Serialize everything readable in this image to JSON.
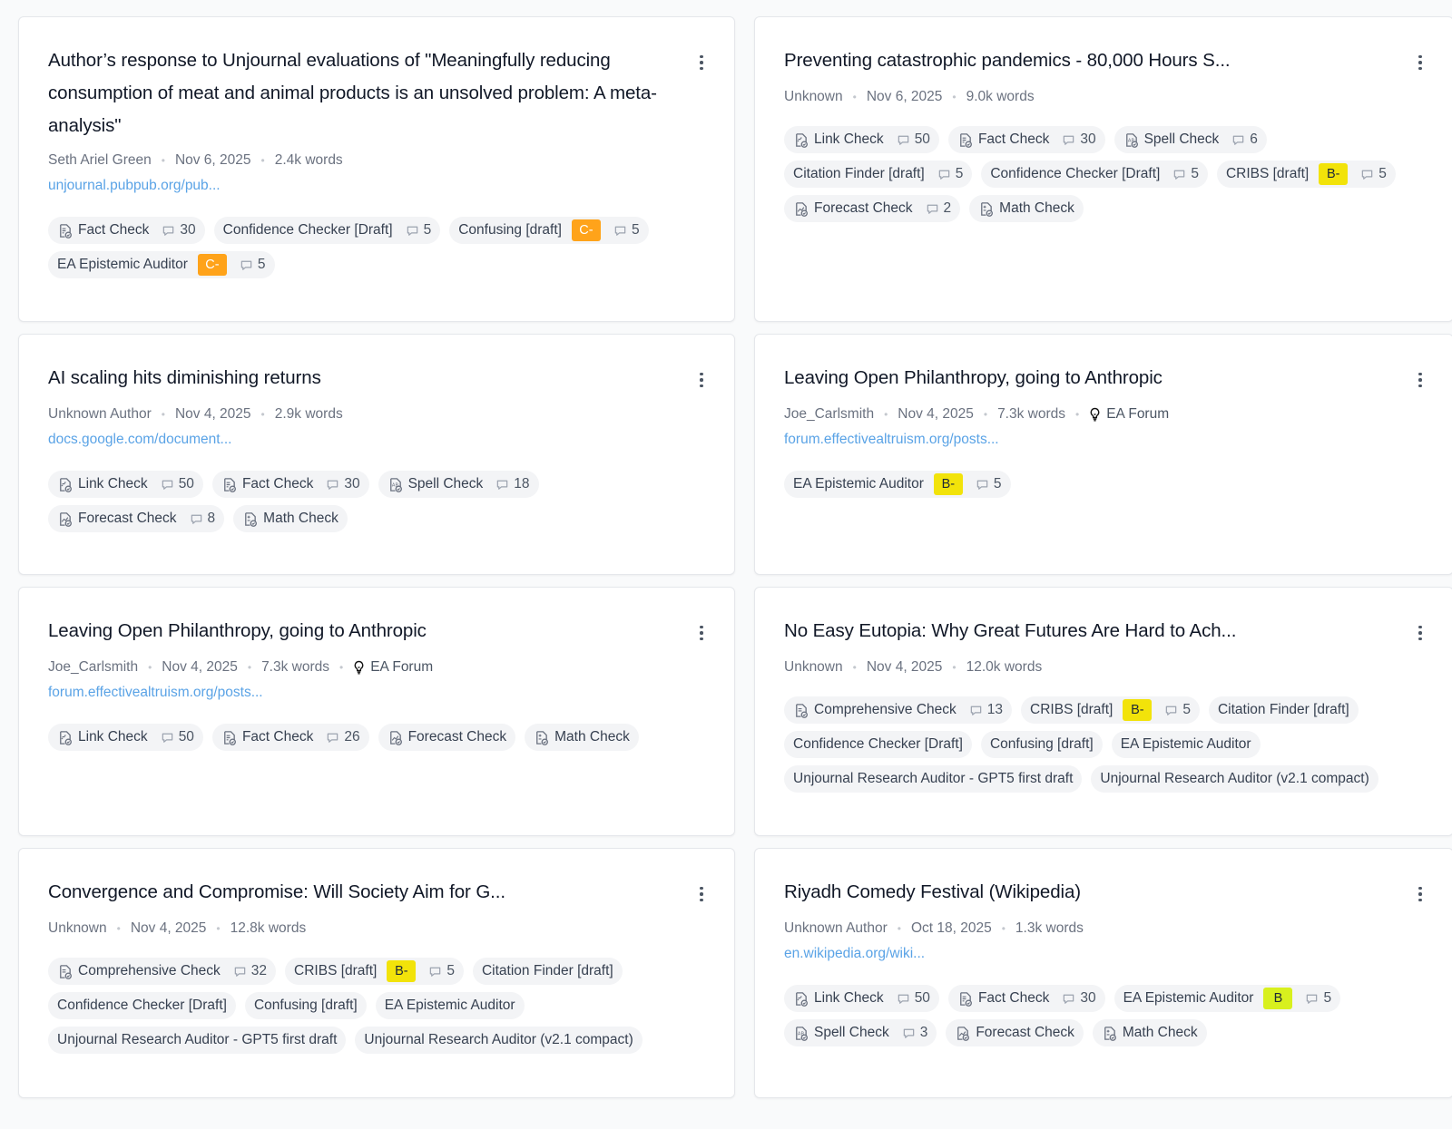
{
  "cards": [
    {
      "title": "Author’s response to Unjournal evaluations of \"Meaningfully reducing consumption of meat and animal products is an unsolved problem: A meta-analysis\"",
      "author": "Seth Ariel Green",
      "date": "Nov 6, 2025",
      "words": "2.4k words",
      "platform": "",
      "link": "unjournal.pubpub.org/pub...",
      "tags": [
        {
          "label": "Fact Check",
          "icon": "fact-check-icon",
          "comments": "30",
          "grade": ""
        },
        {
          "label": "Confidence Checker [Draft]",
          "icon": "",
          "comments": "5",
          "grade": ""
        },
        {
          "label": "Confusing [draft]",
          "icon": "",
          "comments": "5",
          "grade": "C-"
        },
        {
          "label": "EA Epistemic Auditor",
          "icon": "",
          "comments": "5",
          "grade": "C-"
        }
      ]
    },
    {
      "title": "Preventing catastrophic pandemics - 80,000 Hours S...",
      "author": "Unknown",
      "date": "Nov 6, 2025",
      "words": "9.0k words",
      "platform": "",
      "link": "",
      "tags": [
        {
          "label": "Link Check",
          "icon": "link-check-icon",
          "comments": "50",
          "grade": ""
        },
        {
          "label": "Fact Check",
          "icon": "fact-check-icon",
          "comments": "30",
          "grade": ""
        },
        {
          "label": "Spell Check",
          "icon": "spell-check-icon",
          "comments": "6",
          "grade": ""
        },
        {
          "label": "Citation Finder [draft]",
          "icon": "",
          "comments": "5",
          "grade": ""
        },
        {
          "label": "Confidence Checker [Draft]",
          "icon": "",
          "comments": "5",
          "grade": ""
        },
        {
          "label": "CRIBS [draft]",
          "icon": "",
          "comments": "5",
          "grade": "B-"
        },
        {
          "label": "Forecast Check",
          "icon": "forecast-check-icon",
          "comments": "2",
          "grade": ""
        },
        {
          "label": "Math Check",
          "icon": "math-check-icon",
          "comments": "",
          "grade": ""
        }
      ]
    },
    {
      "title": "AI scaling hits diminishing returns",
      "author": "Unknown Author",
      "date": "Nov 4, 2025",
      "words": "2.9k words",
      "platform": "",
      "link": "docs.google.com/document...",
      "tags": [
        {
          "label": "Link Check",
          "icon": "link-check-icon",
          "comments": "50",
          "grade": ""
        },
        {
          "label": "Fact Check",
          "icon": "fact-check-icon",
          "comments": "30",
          "grade": ""
        },
        {
          "label": "Spell Check",
          "icon": "spell-check-icon",
          "comments": "18",
          "grade": ""
        },
        {
          "label": "Forecast Check",
          "icon": "forecast-check-icon",
          "comments": "8",
          "grade": ""
        },
        {
          "label": "Math Check",
          "icon": "math-check-icon",
          "comments": "",
          "grade": ""
        }
      ]
    },
    {
      "title": "Leaving Open Philanthropy, going to Anthropic",
      "author": "Joe_Carlsmith",
      "date": "Nov 4, 2025",
      "words": "7.3k words",
      "platform": "EA Forum",
      "link": "forum.effectivealtruism.org/posts...",
      "tags": [
        {
          "label": "EA Epistemic Auditor",
          "icon": "",
          "comments": "5",
          "grade": "B-"
        }
      ]
    },
    {
      "title": "Leaving Open Philanthropy, going to Anthropic",
      "author": "Joe_Carlsmith",
      "date": "Nov 4, 2025",
      "words": "7.3k words",
      "platform": "EA Forum",
      "link": "forum.effectivealtruism.org/posts...",
      "tags": [
        {
          "label": "Link Check",
          "icon": "link-check-icon",
          "comments": "50",
          "grade": ""
        },
        {
          "label": "Fact Check",
          "icon": "fact-check-icon",
          "comments": "26",
          "grade": ""
        },
        {
          "label": "Forecast Check",
          "icon": "forecast-check-icon",
          "comments": "",
          "grade": ""
        },
        {
          "label": "Math Check",
          "icon": "math-check-icon",
          "comments": "",
          "grade": ""
        }
      ]
    },
    {
      "title": "No Easy Eutopia: Why Great Futures Are Hard to Ach...",
      "author": "Unknown",
      "date": "Nov 4, 2025",
      "words": "12.0k words",
      "platform": "",
      "link": "",
      "tags": [
        {
          "label": "Comprehensive Check",
          "icon": "comprehensive-check-icon",
          "comments": "13",
          "grade": ""
        },
        {
          "label": "CRIBS [draft]",
          "icon": "",
          "comments": "5",
          "grade": "B-"
        },
        {
          "label": "Citation Finder [draft]",
          "icon": "",
          "comments": "",
          "grade": ""
        },
        {
          "label": "Confidence Checker [Draft]",
          "icon": "",
          "comments": "",
          "grade": ""
        },
        {
          "label": "Confusing [draft]",
          "icon": "",
          "comments": "",
          "grade": ""
        },
        {
          "label": "EA Epistemic Auditor",
          "icon": "",
          "comments": "",
          "grade": ""
        },
        {
          "label": "Unjournal Research Auditor - GPT5 first draft",
          "icon": "",
          "comments": "",
          "grade": ""
        },
        {
          "label": "Unjournal Research Auditor (v2.1 compact)",
          "icon": "",
          "comments": "",
          "grade": ""
        }
      ]
    },
    {
      "title": "Convergence and Compromise: Will Society Aim for G...",
      "author": "Unknown",
      "date": "Nov 4, 2025",
      "words": "12.8k words",
      "platform": "",
      "link": "",
      "tags": [
        {
          "label": "Comprehensive Check",
          "icon": "comprehensive-check-icon",
          "comments": "32",
          "grade": ""
        },
        {
          "label": "CRIBS [draft]",
          "icon": "",
          "comments": "5",
          "grade": "B-"
        },
        {
          "label": "Citation Finder [draft]",
          "icon": "",
          "comments": "",
          "grade": ""
        },
        {
          "label": "Confidence Checker [Draft]",
          "icon": "",
          "comments": "",
          "grade": ""
        },
        {
          "label": "Confusing [draft]",
          "icon": "",
          "comments": "",
          "grade": ""
        },
        {
          "label": "EA Epistemic Auditor",
          "icon": "",
          "comments": "",
          "grade": ""
        },
        {
          "label": "Unjournal Research Auditor - GPT5 first draft",
          "icon": "",
          "comments": "",
          "grade": ""
        },
        {
          "label": "Unjournal Research Auditor (v2.1 compact)",
          "icon": "",
          "comments": "",
          "grade": ""
        }
      ]
    },
    {
      "title": "Riyadh Comedy Festival (Wikipedia)",
      "author": "Unknown Author",
      "date": "Oct 18, 2025",
      "words": "1.3k words",
      "platform": "",
      "link": "en.wikipedia.org/wiki...",
      "tags": [
        {
          "label": "Link Check",
          "icon": "link-check-icon",
          "comments": "50",
          "grade": ""
        },
        {
          "label": "Fact Check",
          "icon": "fact-check-icon",
          "comments": "30",
          "grade": ""
        },
        {
          "label": "EA Epistemic Auditor",
          "icon": "",
          "comments": "5",
          "grade": "B"
        },
        {
          "label": "Spell Check",
          "icon": "spell-check-icon",
          "comments": "3",
          "grade": ""
        },
        {
          "label": "Forecast Check",
          "icon": "forecast-check-icon",
          "comments": "",
          "grade": ""
        },
        {
          "label": "Math Check",
          "icon": "math-check-icon",
          "comments": "",
          "grade": ""
        }
      ]
    }
  ],
  "grade_colors": {
    "C-": "#ffa31a",
    "B-": "#f2e30a",
    "B": "#d8f01e"
  }
}
